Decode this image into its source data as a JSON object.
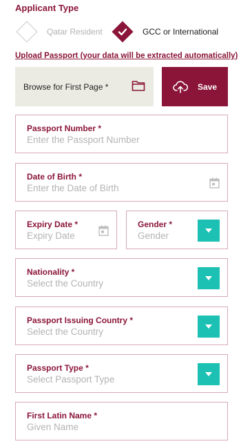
{
  "applicant_type": {
    "title": "Applicant Type",
    "options": [
      {
        "label": "Qatar Resident",
        "selected": false
      },
      {
        "label": "GCC or International",
        "selected": true
      }
    ]
  },
  "upload": {
    "link_text": "Upload Passport (your data will be extracted automatically)",
    "browse_label": "Browse for First Page *",
    "save_label": "Save"
  },
  "fields": {
    "passport_number": {
      "label": "Passport Number *",
      "placeholder": "Enter the Passport Number"
    },
    "date_of_birth": {
      "label": "Date of Birth *",
      "placeholder": "Enter the Date of Birth"
    },
    "expiry_date": {
      "label": "Expiry Date *",
      "placeholder": "Expiry Date"
    },
    "gender": {
      "label": "Gender *",
      "placeholder": "Gender"
    },
    "nationality": {
      "label": "Nationality *",
      "placeholder": "Select the Country"
    },
    "issuing_country": {
      "label": "Passport Issuing Country *",
      "placeholder": "Select the Country"
    },
    "passport_type": {
      "label": "Passport Type *",
      "placeholder": "Select Passport Type"
    },
    "first_latin_name": {
      "label": "First Latin Name *",
      "placeholder": "Given Name"
    }
  },
  "colors": {
    "brand": "#8a1538",
    "accent": "#1cc1b3",
    "border": "#d7a7b5",
    "placeholder": "#b3b3b3"
  },
  "icons": {
    "folder": "folder-icon",
    "upload": "cloud-upload-icon",
    "calendar": "calendar-icon",
    "dropdown": "chevron-down-icon",
    "check": "check-icon"
  }
}
